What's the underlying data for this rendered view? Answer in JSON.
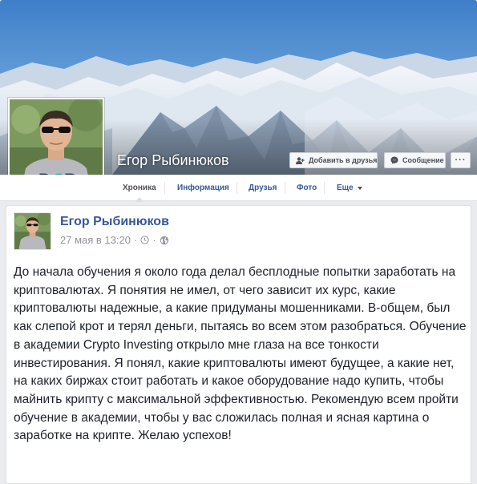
{
  "profile": {
    "name": "Егор Рыбинюков",
    "cover_icon": "mountain-landscape-cover",
    "avatar_icon": "user-photo-avatar"
  },
  "actions": {
    "add_friend": {
      "label": "Добавить в друзья",
      "icon": "add-friend-icon"
    },
    "message": {
      "label": "Сообщение",
      "icon": "messenger-icon"
    },
    "more": {
      "label": "···"
    }
  },
  "tabs": [
    {
      "label": "Хроника",
      "active": true
    },
    {
      "label": "Информация"
    },
    {
      "label": "Друзья"
    },
    {
      "label": "Фото"
    },
    {
      "label": "Еще"
    }
  ],
  "post": {
    "author": "Егор Рыбинюков",
    "date": "27 мая в 13:20",
    "separator": "·",
    "icons": [
      "clock-icon",
      "globe-icon"
    ],
    "text": "До начала обучения я около года делал бесплодные попытки заработать на криптовалютах. Я понятия не имел, от чего зависит их курс, какие криптовалюты надежные, а какие придуманы мошенниками. В-общем, был как слепой крот и терял деньги, пытаясь во всем этом разобраться. Обучение в академии Crypto Investing открыло мне глаза на все тонкости инвестирования. Я понял, какие криптовалюты имеют будущее, а какие нет, на каких биржах стоит работать и какое оборудование надо купить, чтобы майнить крипту с максимальной эффективностью. Рекомендую всем пройти обучение в академии, чтобы у вас сложилась полная и ясная картина о заработке на крипте. Желаю успехов!"
  },
  "colors": {
    "link": "#365899",
    "muted": "#90949c",
    "text": "#1d2129",
    "background": "#e9ebee"
  }
}
